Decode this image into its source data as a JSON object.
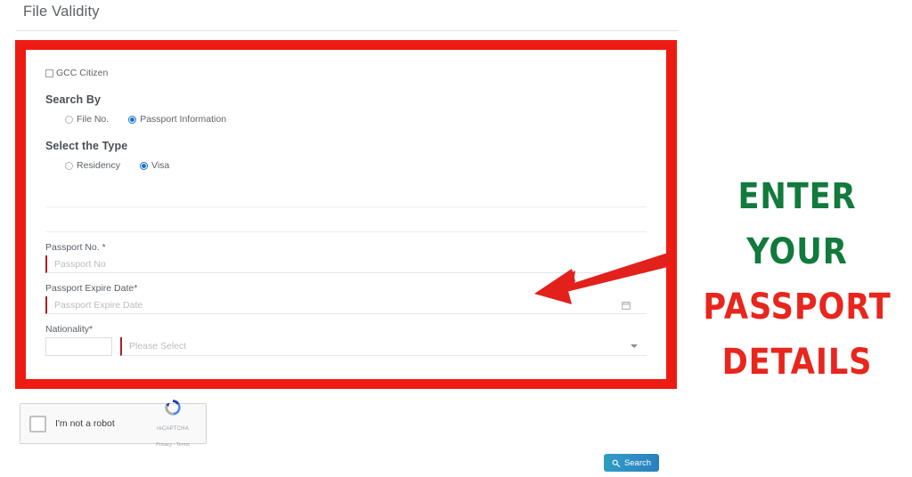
{
  "header": {
    "title": "File Validity"
  },
  "form": {
    "gcc_citizen": {
      "label": "GCC Citizen",
      "checked": false
    },
    "search_by": {
      "title": "Search By",
      "options": [
        {
          "label": "File No.",
          "selected": false
        },
        {
          "label": "Passport Information",
          "selected": true
        }
      ]
    },
    "select_type": {
      "title": "Select the Type",
      "options": [
        {
          "label": "Residency",
          "selected": false
        },
        {
          "label": "Visa",
          "selected": true
        }
      ]
    },
    "fields": {
      "passport_no": {
        "label": "Passport No. *",
        "placeholder": "Passport No",
        "value": ""
      },
      "passport_expire": {
        "label": "Passport Expire Date*",
        "placeholder": "Passport Expire Date",
        "value": "",
        "icon": "calendar-icon"
      },
      "nationality": {
        "label": "Nationality*",
        "code_value": "",
        "placeholder": "Please Select",
        "icon": "chevron-down-icon"
      }
    }
  },
  "recaptcha": {
    "label": "I'm not a robot",
    "brand": "reCAPTCHA",
    "terms": "Privacy - Terms",
    "checked": false
  },
  "search_button": {
    "label": "Search",
    "icon": "search-icon"
  },
  "annotation": {
    "arrow": "left-pointing-arrow",
    "callout": {
      "line1": "ENTER",
      "line2": "YOUR",
      "line3": "PASSPORT",
      "line4": "DETAILS",
      "green": "#127a3c",
      "red": "#e8261d"
    },
    "highlight_color": "#ee1b12"
  }
}
